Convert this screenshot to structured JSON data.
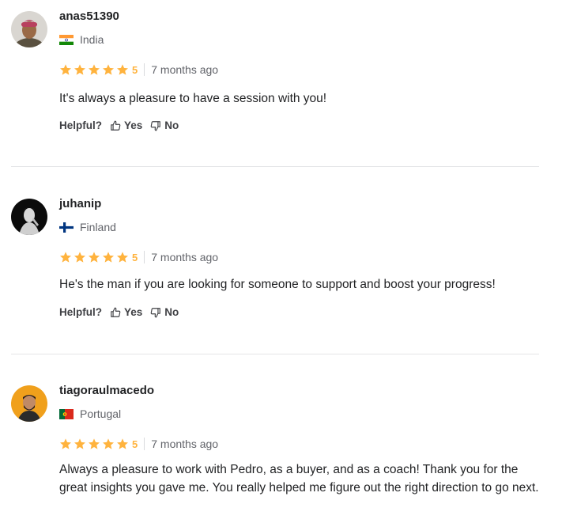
{
  "reviews": [
    {
      "username": "anas51390",
      "country": "India",
      "flag": "india",
      "rating": "5",
      "time": "7 months ago",
      "text": "It's always a pleasure to have a session with you!",
      "helpful_label": "Helpful?",
      "yes_label": "Yes",
      "no_label": "No"
    },
    {
      "username": "juhanip",
      "country": "Finland",
      "flag": "finland",
      "rating": "5",
      "time": "7 months ago",
      "text": "He's the man if you are looking for someone to support and boost your progress!",
      "helpful_label": "Helpful?",
      "yes_label": "Yes",
      "no_label": "No"
    },
    {
      "username": "tiagoraulmacedo",
      "country": "Portugal",
      "flag": "portugal",
      "rating": "5",
      "time": "7 months ago",
      "text": "Always a pleasure to work with Pedro, as a buyer, and as a coach! Thank you for the great insights you gave me. You really helped me figure out the right direction to go next."
    }
  ],
  "colors": {
    "star": "#ffb33e",
    "text": "#222325",
    "muted": "#62646a",
    "divider": "#e4e5e7"
  }
}
